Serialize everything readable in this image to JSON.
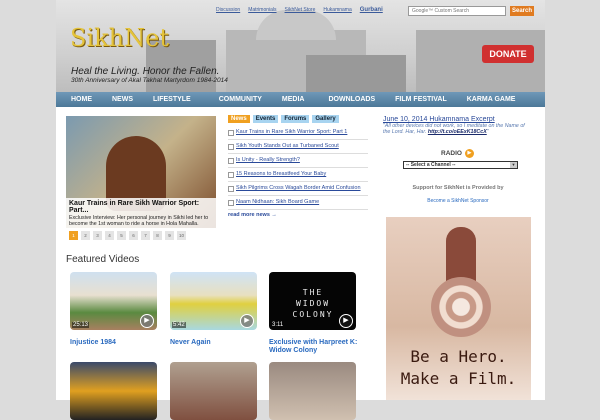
{
  "header": {
    "top_links": [
      "Discussion",
      "Matrimonials",
      "SikhNet Store",
      "Hukamnama",
      "Gurbani"
    ],
    "search_placeholder": "Google™ Custom Search",
    "search_button": "Search",
    "logo": "SikhNet",
    "donate": "DONATE",
    "tagline": "Heal the Living. Honor the Fallen.",
    "subtagline": "30th Anniversary of Akal Takhat Martyrdom 1984-2014"
  },
  "nav": [
    "HOME",
    "NEWS",
    "LIFESTYLE",
    "COMMUNITY",
    "MEDIA",
    "DOWNLOADS",
    "FILM FESTIVAL",
    "KARMA GAME"
  ],
  "slider": {
    "title": "Kaur Trains in Rare Sikh Warrior Sport: Part...",
    "desc": "Exclusive Interview: Her personal journey in Sikhi led her to become the 1st woman to ride a horse in Hola Mahalla.",
    "pages": [
      "1",
      "2",
      "3",
      "4",
      "5",
      "6",
      "7",
      "8",
      "9",
      "10"
    ]
  },
  "featured": {
    "heading": "Featured Videos",
    "videos": [
      {
        "title": "Injustice 1984",
        "duration": "25:13"
      },
      {
        "title": "Never Again",
        "duration": "5:42"
      },
      {
        "title": "Exclusive with Harpreet K: Widow Colony",
        "duration": "3:11",
        "thumb_text": "THE WIDOW COLONY"
      }
    ]
  },
  "news": {
    "tabs": [
      "News",
      "Events",
      "Forums",
      "Gallery"
    ],
    "items": [
      "Kaur Trains in Rare Sikh Warrior Sport: Part 1",
      "Sikh Youth Stands Out as Turbaned Scout",
      "Is Unity - Really Strength?",
      "15 Reasons to Breastfeed Your Baby",
      "Sikh Pilgrims Cross Wagah Border Amid Confusion",
      "Naam Nidhaan: Sikh Board Game"
    ],
    "more": "read more news →"
  },
  "hukamnama": {
    "title": "June 10, 2014 Hukamnama Excerpt",
    "quote": "\"All other devices did not work, so I meditate on the Name of the Lord. Har, Har. ",
    "link": "http://t.co/oEExK18CcX",
    "end": "\""
  },
  "radio": {
    "label": "RADIO",
    "select": "-- Select a Channel --"
  },
  "support": {
    "text": "Support for SikhNet is Provided by",
    "link": "Become a SikhNet Sponsor"
  },
  "ad": {
    "line1": "Be a Hero.",
    "line2": "Make a Film."
  }
}
